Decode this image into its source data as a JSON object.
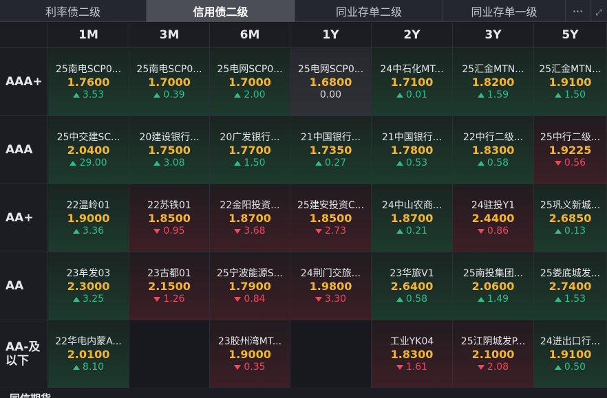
{
  "tabs": [
    {
      "label": "利率债二级",
      "active": false
    },
    {
      "label": "信用债二级",
      "active": true
    },
    {
      "label": "同业存单二级",
      "active": false
    },
    {
      "label": "同业存单一级",
      "active": false
    }
  ],
  "tab_more_label": "···",
  "columns": [
    "1M",
    "3M",
    "6M",
    "1Y",
    "2Y",
    "3Y",
    "5Y"
  ],
  "rows": [
    {
      "label": "AAA+",
      "cells": [
        {
          "name": "25南电SCP0...",
          "yield": "1.7600",
          "change": "3.53",
          "dir": "up"
        },
        {
          "name": "25南电SCP0...",
          "yield": "1.7000",
          "change": "0.39",
          "dir": "up"
        },
        {
          "name": "25电网SCP0...",
          "yield": "1.7000",
          "change": "2.00",
          "dir": "up"
        },
        {
          "name": "25电网SCP0...",
          "yield": "1.6800",
          "change": "0.00",
          "dir": "flat"
        },
        {
          "name": "24中石化MT...",
          "yield": "1.7100",
          "change": "0.01",
          "dir": "up"
        },
        {
          "name": "25汇金MTN...",
          "yield": "1.8200",
          "change": "1.59",
          "dir": "up"
        },
        {
          "name": "25汇金MTN...",
          "yield": "1.9100",
          "change": "1.50",
          "dir": "up"
        }
      ]
    },
    {
      "label": "AAA",
      "cells": [
        {
          "name": "25中交建SC...",
          "yield": "2.0400",
          "change": "29.00",
          "dir": "up"
        },
        {
          "name": "20建设银行...",
          "yield": "1.7500",
          "change": "3.08",
          "dir": "up"
        },
        {
          "name": "20广发银行...",
          "yield": "1.7700",
          "change": "1.50",
          "dir": "up"
        },
        {
          "name": "21中国银行...",
          "yield": "1.7350",
          "change": "0.27",
          "dir": "up"
        },
        {
          "name": "21中国银行...",
          "yield": "1.7800",
          "change": "0.53",
          "dir": "up"
        },
        {
          "name": "22中行二级...",
          "yield": "1.8300",
          "change": "0.58",
          "dir": "up"
        },
        {
          "name": "25中行二级...",
          "yield": "1.9225",
          "change": "0.56",
          "dir": "down"
        }
      ]
    },
    {
      "label": "AA+",
      "cells": [
        {
          "name": "22温岭01",
          "yield": "1.9000",
          "change": "3.36",
          "dir": "up"
        },
        {
          "name": "22苏铁01",
          "yield": "1.8500",
          "change": "0.95",
          "dir": "down"
        },
        {
          "name": "22金阳投资...",
          "yield": "1.8700",
          "change": "3.68",
          "dir": "down"
        },
        {
          "name": "25建安投资C...",
          "yield": "1.8500",
          "change": "2.73",
          "dir": "down"
        },
        {
          "name": "24中山农商...",
          "yield": "1.8700",
          "change": "0.21",
          "dir": "up"
        },
        {
          "name": "24驻投Y1",
          "yield": "2.4400",
          "change": "0.86",
          "dir": "down"
        },
        {
          "name": "25巩义新城...",
          "yield": "2.6850",
          "change": "0.13",
          "dir": "up"
        }
      ]
    },
    {
      "label": "AA",
      "cells": [
        {
          "name": "23牟发03",
          "yield": "2.3000",
          "change": "3.25",
          "dir": "up"
        },
        {
          "name": "23古都01",
          "yield": "2.1500",
          "change": "1.26",
          "dir": "down"
        },
        {
          "name": "25宁波能源S...",
          "yield": "1.7900",
          "change": "0.84",
          "dir": "down"
        },
        {
          "name": "24荆门交旅...",
          "yield": "1.9800",
          "change": "3.30",
          "dir": "down"
        },
        {
          "name": "23华旅V1",
          "yield": "2.6400",
          "change": "0.58",
          "dir": "up"
        },
        {
          "name": "25南投集团...",
          "yield": "2.0600",
          "change": "1.49",
          "dir": "up"
        },
        {
          "name": "25娄底城发...",
          "yield": "2.7400",
          "change": "1.53",
          "dir": "up"
        }
      ]
    },
    {
      "label": "AA-及\n以下",
      "cells": [
        {
          "name": "22华电内蒙A...",
          "yield": "2.0100",
          "change": "8.10",
          "dir": "up"
        },
        null,
        {
          "name": "23胶州湾MT...",
          "yield": "1.9000",
          "change": "0.35",
          "dir": "down"
        },
        null,
        {
          "name": "工业YK04",
          "yield": "1.8300",
          "change": "1.61",
          "dir": "down"
        },
        {
          "name": "25江阴城发P...",
          "yield": "2.1000",
          "change": "2.08",
          "dir": "down"
        },
        {
          "name": "24进出口行...",
          "yield": "1.9100",
          "change": "0.50",
          "dir": "up"
        }
      ]
    }
  ],
  "footer_label": "同信期货"
}
